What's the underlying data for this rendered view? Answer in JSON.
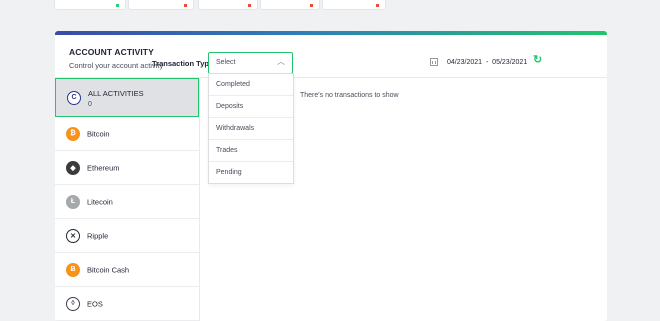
{
  "panel": {
    "title": "ACCOUNT ACTIVITY",
    "subtitle": "Control your account activity"
  },
  "sidebar": {
    "items": [
      {
        "label": "ALL ACTIVITIES",
        "count": "0",
        "icon": "all-activities-icon",
        "color": "#2b3590",
        "active": true
      },
      {
        "label": "Bitcoin",
        "icon": "bitcoin-icon",
        "color": "#f7931a"
      },
      {
        "label": "Ethereum",
        "icon": "ethereum-icon",
        "color": "#3c3c3d"
      },
      {
        "label": "Litecoin",
        "icon": "litecoin-icon",
        "color": "#a6a9aa"
      },
      {
        "label": "Ripple",
        "icon": "ripple-icon",
        "color": "#23292f"
      },
      {
        "label": "Bitcoin Cash",
        "icon": "bitcoin-cash-icon",
        "color": "#f7931a"
      },
      {
        "label": "EOS",
        "icon": "eos-icon",
        "color": "#3a3f4a"
      }
    ]
  },
  "filter": {
    "label": "Transaction Type",
    "select_value": "Select",
    "options": [
      "Completed",
      "Deposits",
      "Withdrawals",
      "Trades",
      "Pending"
    ]
  },
  "date": {
    "start": "04/23/2021",
    "separator": "-",
    "end": "05/23/2021"
  },
  "empty_message": "There's no transactions to show",
  "colors": {
    "accent": "#23c46d",
    "gradient_start": "#3b4ba8",
    "gradient_end": "#23c46d"
  }
}
